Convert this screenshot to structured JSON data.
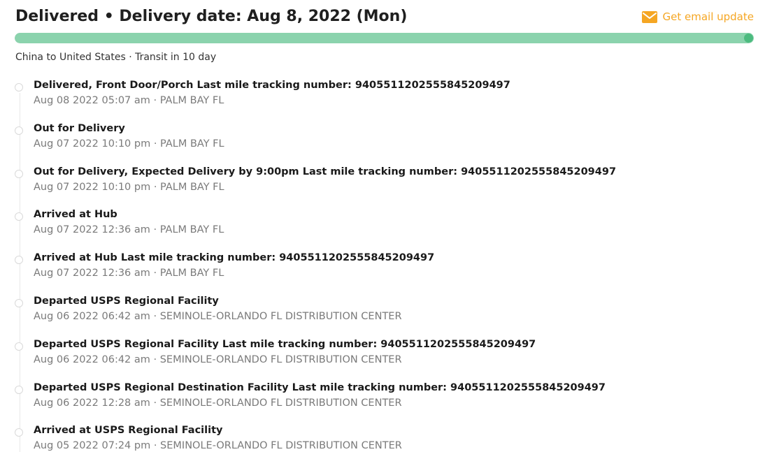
{
  "header": {
    "title": "Delivered • Delivery date: Aug 8, 2022 (Mon)",
    "email_label": "Get email update"
  },
  "progress": {
    "fraction": 1.0
  },
  "route": "China to United States · Transit in 10 day",
  "colors": {
    "accent_orange": "#f5a623",
    "progress_green": "#8bd3ad",
    "progress_dot": "#4cbb7f",
    "dot_border": "#d9d9d9"
  },
  "icons": {
    "email": "mail-icon"
  },
  "events": [
    {
      "title": "Delivered, Front Door/Porch Last mile tracking number: 9405511202555845209497",
      "meta": "Aug 08 2022 05:07 am · PALM BAY FL"
    },
    {
      "title": "Out for Delivery",
      "meta": "Aug 07 2022 10:10 pm · PALM BAY FL"
    },
    {
      "title": "Out for Delivery, Expected Delivery by 9:00pm Last mile tracking number: 9405511202555845209497",
      "meta": "Aug 07 2022 10:10 pm · PALM BAY FL"
    },
    {
      "title": "Arrived at Hub",
      "meta": "Aug 07 2022 12:36 am · PALM BAY FL"
    },
    {
      "title": "Arrived at Hub Last mile tracking number: 9405511202555845209497",
      "meta": "Aug 07 2022 12:36 am · PALM BAY FL"
    },
    {
      "title": "Departed USPS Regional Facility",
      "meta": "Aug 06 2022 06:42 am · SEMINOLE-ORLANDO FL DISTRIBUTION CENTER"
    },
    {
      "title": "Departed USPS Regional Facility Last mile tracking number: 9405511202555845209497",
      "meta": "Aug 06 2022 06:42 am · SEMINOLE-ORLANDO FL DISTRIBUTION CENTER"
    },
    {
      "title": "Departed USPS Regional Destination Facility Last mile tracking number: 9405511202555845209497",
      "meta": "Aug 06 2022 12:28 am · SEMINOLE-ORLANDO FL DISTRIBUTION CENTER"
    },
    {
      "title": "Arrived at USPS Regional Facility",
      "meta": "Aug 05 2022 07:24 pm · SEMINOLE-ORLANDO FL DISTRIBUTION CENTER"
    }
  ]
}
